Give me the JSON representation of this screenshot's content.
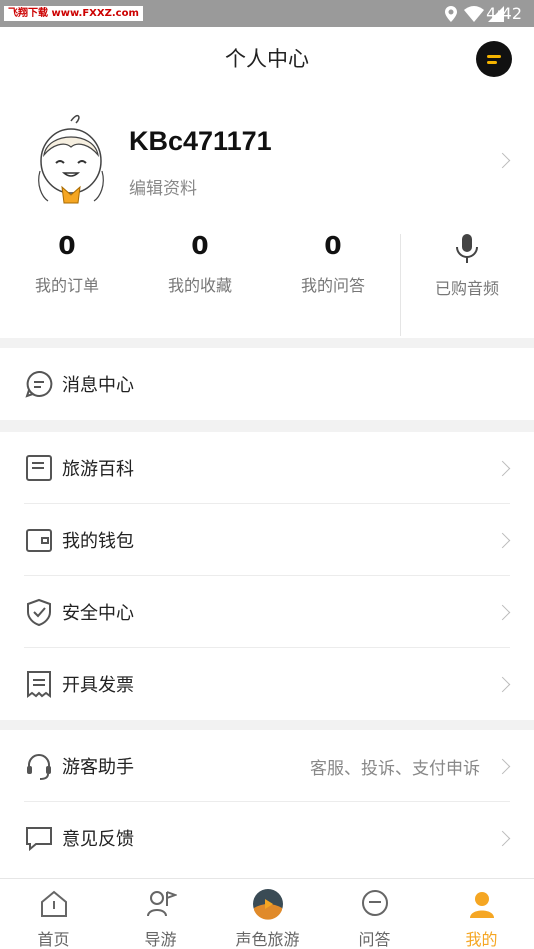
{
  "status_bar": {
    "watermark": "飞翔下载 www.FXXZ.com",
    "time": "4:42"
  },
  "header": {
    "title": "个人中心"
  },
  "profile": {
    "username": "KBc471171",
    "edit_label": "编辑资料"
  },
  "stats": [
    {
      "value": "0",
      "label": "我的订单"
    },
    {
      "value": "0",
      "label": "我的收藏"
    },
    {
      "value": "0",
      "label": "我的问答"
    }
  ],
  "audio": {
    "label": "已购音频"
  },
  "menu": {
    "message_center": "消息中心",
    "travel_wiki": "旅游百科",
    "wallet": "我的钱包",
    "security": "安全中心",
    "invoice": "开具发票",
    "assistant": "游客助手",
    "assistant_extra": "客服、投诉、支付申诉",
    "feedback": "意见反馈"
  },
  "tabs": [
    {
      "label": "首页"
    },
    {
      "label": "导游"
    },
    {
      "label": "声色旅游"
    },
    {
      "label": "问答"
    },
    {
      "label": "我的"
    }
  ],
  "colors": {
    "accent": "#f5a623",
    "header_bg": "#ffffff",
    "page_bg": "#f2f2f2"
  }
}
